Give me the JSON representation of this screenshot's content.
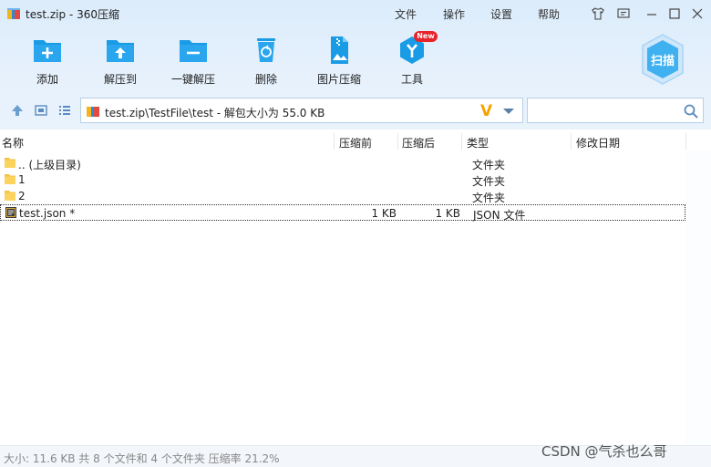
{
  "window": {
    "title": "test.zip - 360压缩"
  },
  "menu": {
    "file": "文件",
    "operate": "操作",
    "settings": "设置",
    "help": "帮助"
  },
  "toolbar": {
    "add": "添加",
    "extract_to": "解压到",
    "one_click": "一键解压",
    "delete": "删除",
    "image_compress": "图片压缩",
    "tools": "工具",
    "new_badge": "New",
    "scan": "扫描"
  },
  "address": {
    "path": "test.zip\\TestFile\\test - 解包大小为 55.0 KB",
    "search_placeholder": ""
  },
  "columns": {
    "name": "名称",
    "before": "压缩前",
    "after": "压缩后",
    "type": "类型",
    "modified": "修改日期"
  },
  "files": [
    {
      "name": ".. (上级目录)",
      "before": "",
      "after": "",
      "type": "文件夹",
      "icon": "folder-icon"
    },
    {
      "name": "1",
      "before": "",
      "after": "",
      "type": "文件夹",
      "icon": "folder-icon"
    },
    {
      "name": "2",
      "before": "",
      "after": "",
      "type": "文件夹",
      "icon": "folder-icon"
    },
    {
      "name": "test.json *",
      "before": "1 KB",
      "after": "1 KB",
      "type": "JSON 文件",
      "icon": "json-file-icon"
    }
  ],
  "status": "大小: 11.6 KB 共 8 个文件和 4 个文件夹 压缩率 21.2%",
  "watermark": "CSDN @气杀也么哥",
  "colors": {
    "accent": "#1a9be6",
    "badge": "#e8232a",
    "folder": "#f6c244"
  }
}
